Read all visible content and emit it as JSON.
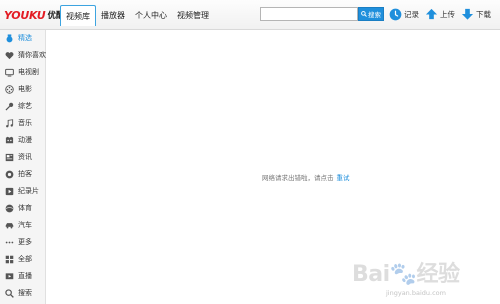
{
  "app": {
    "logo_text_a": "YOU",
    "logo_text_b": "KU",
    "logo_cn": "优酷",
    "logo_caret": "▾",
    "accent": "#1f8fdc",
    "brand_red": "#e31b23"
  },
  "nav": {
    "tabs": [
      {
        "label": "视频库",
        "active": true
      },
      {
        "label": "播放器",
        "active": false
      },
      {
        "label": "个人中心",
        "active": false
      },
      {
        "label": "视频管理",
        "active": false
      }
    ]
  },
  "search": {
    "value": "",
    "placeholder": "",
    "button_label": "搜索",
    "icon": "search-icon"
  },
  "actions": [
    {
      "label": "记录",
      "icon": "clock-icon"
    },
    {
      "label": "上传",
      "icon": "upload-arrow-icon"
    },
    {
      "label": "下载",
      "icon": "download-arrow-icon"
    }
  ],
  "sidebar": {
    "items": [
      {
        "label": "精选",
        "icon": "featured-icon",
        "active": true
      },
      {
        "label": "猜你喜欢",
        "icon": "heart-icon",
        "active": false
      },
      {
        "label": "电视剧",
        "icon": "tv-icon",
        "active": false
      },
      {
        "label": "电影",
        "icon": "film-reel-icon",
        "active": false
      },
      {
        "label": "综艺",
        "icon": "microphone-icon",
        "active": false
      },
      {
        "label": "音乐",
        "icon": "music-note-icon",
        "active": false
      },
      {
        "label": "动漫",
        "icon": "cartoon-face-icon",
        "active": false
      },
      {
        "label": "资讯",
        "icon": "news-icon",
        "active": false
      },
      {
        "label": "拍客",
        "icon": "camera-icon",
        "active": false
      },
      {
        "label": "纪录片",
        "icon": "documentary-icon",
        "active": false
      },
      {
        "label": "体育",
        "icon": "ball-icon",
        "active": false
      },
      {
        "label": "汽车",
        "icon": "car-icon",
        "active": false
      },
      {
        "label": "更多",
        "icon": "more-dots-icon",
        "active": false
      },
      {
        "label": "全部",
        "icon": "grid-icon",
        "active": false
      },
      {
        "label": "直播",
        "icon": "live-icon",
        "active": false
      },
      {
        "label": "搜索",
        "icon": "search-icon",
        "active": false
      }
    ]
  },
  "main": {
    "message": "网络请求出错啦，请点击",
    "retry_label": "重试"
  },
  "watermark": {
    "text": "Bai🐾经验",
    "sub": "jingyan.baidu.com"
  }
}
